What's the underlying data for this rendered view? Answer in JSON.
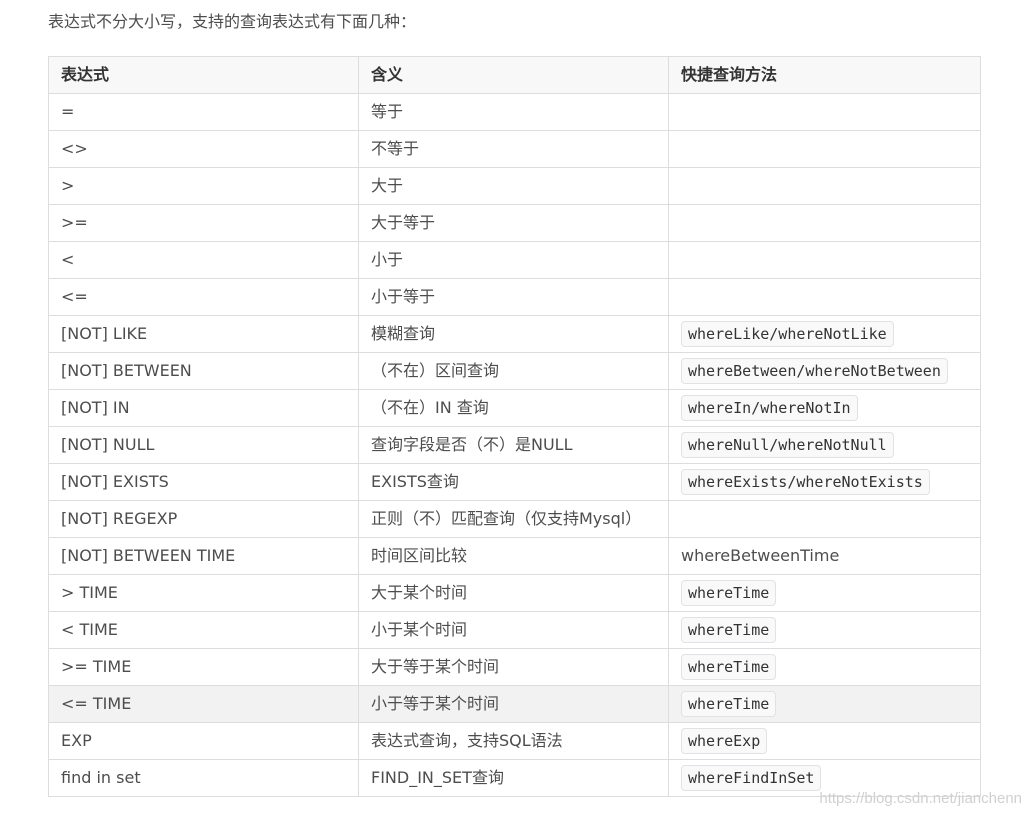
{
  "intro": "表达式不分大小写，支持的查询表达式有下面几种：",
  "table": {
    "headers": [
      "表达式",
      "含义",
      "快捷查询方法"
    ],
    "rows": [
      {
        "expr": "=",
        "meaning": "等于",
        "method": "",
        "code": false
      },
      {
        "expr": "<>",
        "meaning": "不等于",
        "method": "",
        "code": false
      },
      {
        "expr": ">",
        "meaning": "大于",
        "method": "",
        "code": false
      },
      {
        "expr": ">=",
        "meaning": "大于等于",
        "method": "",
        "code": false
      },
      {
        "expr": "<",
        "meaning": "小于",
        "method": "",
        "code": false
      },
      {
        "expr": "<=",
        "meaning": "小于等于",
        "method": "",
        "code": false
      },
      {
        "expr": "[NOT] LIKE",
        "meaning": "模糊查询",
        "method": "whereLike/whereNotLike",
        "code": true
      },
      {
        "expr": "[NOT] BETWEEN",
        "meaning": "（不在）区间查询",
        "method": "whereBetween/whereNotBetween",
        "code": true
      },
      {
        "expr": "[NOT] IN",
        "meaning": "（不在）IN 查询",
        "method": "whereIn/whereNotIn",
        "code": true
      },
      {
        "expr": "[NOT] NULL",
        "meaning": "查询字段是否（不）是NULL",
        "method": "whereNull/whereNotNull",
        "code": true
      },
      {
        "expr": "[NOT] EXISTS",
        "meaning": "EXISTS查询",
        "method": "whereExists/whereNotExists",
        "code": true
      },
      {
        "expr": "[NOT] REGEXP",
        "meaning": "正则（不）匹配查询（仅支持Mysql）",
        "method": "",
        "code": false
      },
      {
        "expr": "[NOT] BETWEEN TIME",
        "meaning": "时间区间比较",
        "method": "whereBetweenTime",
        "code": false
      },
      {
        "expr": "> TIME",
        "meaning": "大于某个时间",
        "method": "whereTime",
        "code": true
      },
      {
        "expr": "< TIME",
        "meaning": "小于某个时间",
        "method": "whereTime",
        "code": true
      },
      {
        "expr": ">= TIME",
        "meaning": "大于等于某个时间",
        "method": "whereTime",
        "code": true
      },
      {
        "expr": "<= TIME",
        "meaning": "小于等于某个时间",
        "method": "whereTime",
        "code": true,
        "highlighted": true
      },
      {
        "expr": "EXP",
        "meaning": "表达式查询，支持SQL语法",
        "method": "whereExp",
        "code": true
      },
      {
        "expr": "find in set",
        "meaning": "FIND_IN_SET查询",
        "method": "whereFindInSet",
        "code": true
      }
    ]
  },
  "watermark": "https://blog.csdn.net/jianchenn"
}
